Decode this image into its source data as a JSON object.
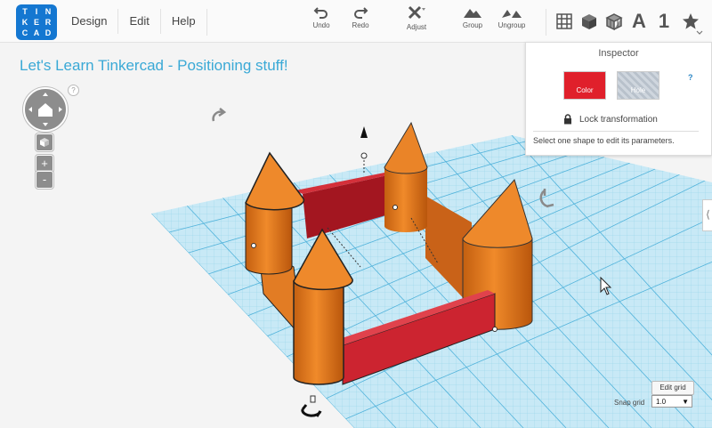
{
  "app": {
    "logo_letters": [
      "T",
      "I",
      "N",
      "K",
      "E",
      "R",
      "C",
      "A",
      "D"
    ],
    "brand_color": "#1477d1"
  },
  "menu": [
    {
      "label": "Design"
    },
    {
      "label": "Edit"
    },
    {
      "label": "Help"
    }
  ],
  "toolbar": {
    "undo": "Undo",
    "redo": "Redo",
    "adjust": "Adjust",
    "group": "Group",
    "ungroup": "Ungroup"
  },
  "right_tools": {
    "text_icon": "A",
    "number_icon": "1"
  },
  "canvas": {
    "title": "Let's Learn Tinkercad - Positioning stuff!",
    "help_mark": "?"
  },
  "view_controls": {
    "zoom_in": "+",
    "zoom_out": "-"
  },
  "inspector": {
    "title": "Inspector",
    "color_label": "Color",
    "hole_label": "Hole",
    "help_mark": "?",
    "lock_label": "Lock transformation",
    "hint": "Select one shape to edit its parameters.",
    "color_value": "#e0202b"
  },
  "grid": {
    "edit_label": "Edit grid",
    "snap_label": "Snap grid",
    "snap_value": "1.0",
    "snap_arrow": "▼"
  },
  "side_tab": "⟨"
}
